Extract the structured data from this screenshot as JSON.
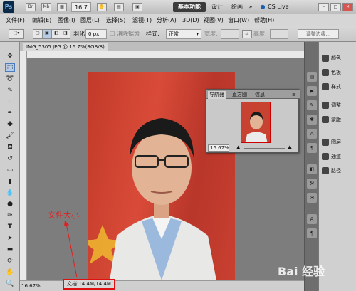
{
  "appbar": {
    "logo": "Ps",
    "br": "Br",
    "mb": "Mb",
    "zoom": "16.7",
    "workspace_active": "基本功能",
    "workspace_design": "设计",
    "workspace_draw": "绘画",
    "cs_live": "CS Live"
  },
  "menubar": {
    "items": [
      "文件(F)",
      "编辑(E)",
      "图像(I)",
      "图层(L)",
      "选择(S)",
      "滤镜(T)",
      "分析(A)",
      "3D(D)",
      "视图(V)",
      "窗口(W)",
      "帮助(H)"
    ]
  },
  "optbar": {
    "feather_label": "羽化:",
    "feather_value": "0 px",
    "antialias": "消除锯齿",
    "style_label": "样式:",
    "style_value": "正常",
    "width_label": "宽度:",
    "height_label": "高度:",
    "refine": "调整边缘..."
  },
  "document": {
    "tab": "IMG_5305.JPG @ 16.7%(RGB/8)",
    "zoom": "16.67%",
    "info": "文档:14.4M/14.4M"
  },
  "navigator": {
    "tabs": [
      "导航器",
      "直方图",
      "信息"
    ],
    "zoom": "16.67%"
  },
  "panels": {
    "items": [
      "颜色",
      "色板",
      "样式",
      "调整",
      "蒙版",
      "图层",
      "通道",
      "路径"
    ]
  },
  "annotation": {
    "text": "文件大小",
    "color": "#e02020"
  },
  "watermark": {
    "text": "Bai 经验"
  }
}
